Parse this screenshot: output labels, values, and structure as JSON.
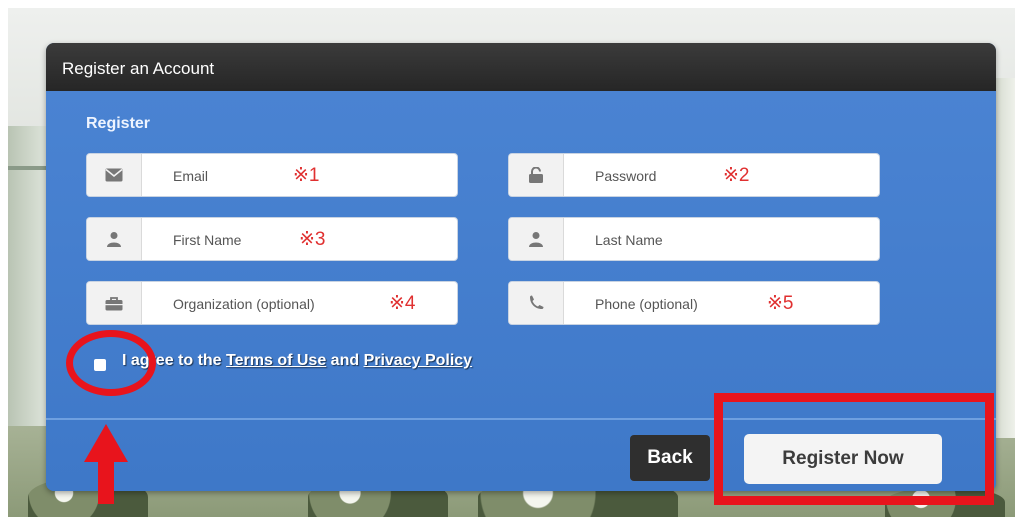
{
  "dialog": {
    "title": "Register an Account",
    "section_label": "Register"
  },
  "fields": {
    "email": {
      "icon": "envelope-icon",
      "placeholder": "Email",
      "annotation": "※1"
    },
    "password": {
      "icon": "lock-icon",
      "placeholder": "Password",
      "annotation": "※2"
    },
    "first_name": {
      "icon": "user-icon",
      "placeholder": "First Name",
      "annotation": "※3"
    },
    "last_name": {
      "icon": "user-icon",
      "placeholder": "Last Name"
    },
    "organization": {
      "icon": "briefcase-icon",
      "placeholder": "Organization (optional)",
      "annotation": "※4"
    },
    "phone": {
      "icon": "phone-icon",
      "placeholder": "Phone (optional)",
      "annotation": "※5"
    }
  },
  "agreement": {
    "checked": false,
    "prefix": "I agree to the ",
    "terms_link": "Terms of Use",
    "middle": " and ",
    "privacy_link": "Privacy Policy"
  },
  "buttons": {
    "back": "Back",
    "register": "Register Now"
  },
  "colors": {
    "dialog_blue": "#3d76c7",
    "titlebar": "#2c2c2c",
    "annotation_red": "#e8141c"
  }
}
